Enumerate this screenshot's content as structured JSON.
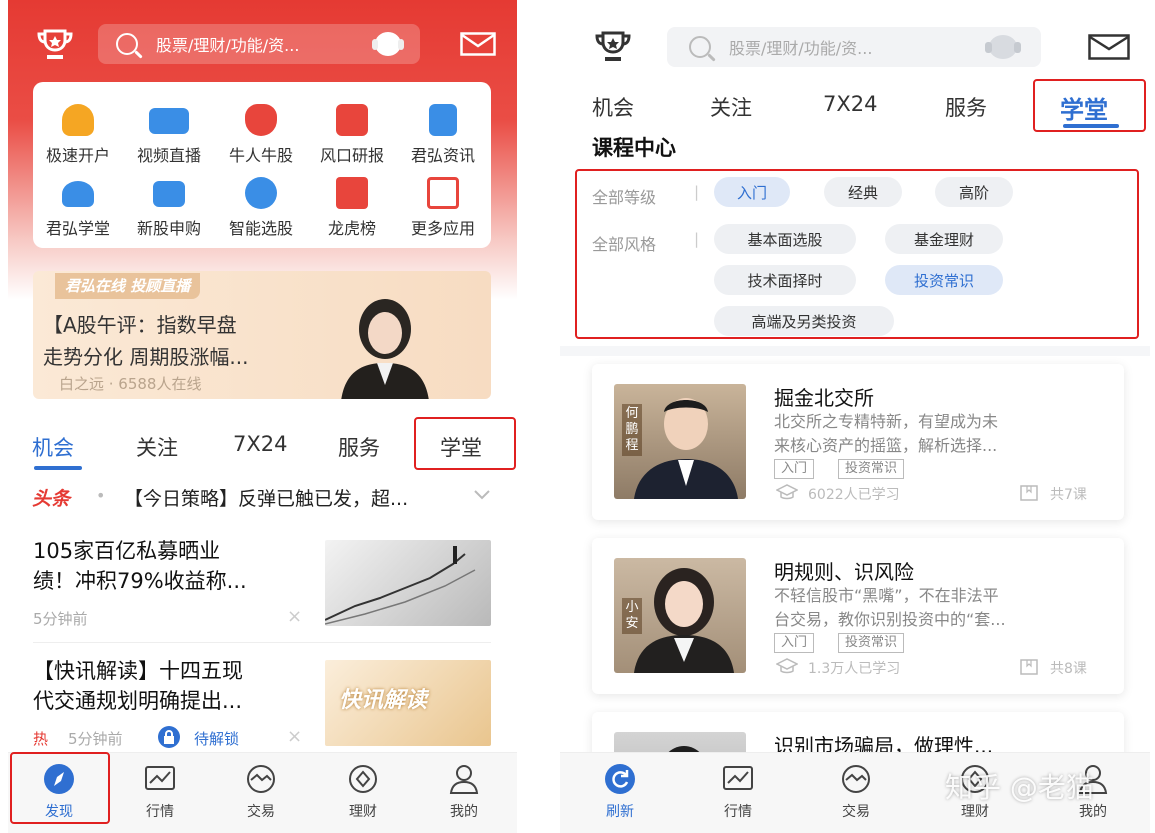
{
  "left": {
    "search_placeholder": "股票/理财/功能/资...",
    "grid": [
      {
        "label": "极速开户",
        "icon": "user-account-icon",
        "color": "#f5a623"
      },
      {
        "label": "视频直播",
        "icon": "video-camera-icon",
        "color": "#3a8ee6"
      },
      {
        "label": "牛人牛股",
        "icon": "bull-icon",
        "color": "#e8453c"
      },
      {
        "label": "风口研报",
        "icon": "report-icon",
        "color": "#e8453c"
      },
      {
        "label": "君弘资讯",
        "icon": "news-doc-icon",
        "color": "#3a8ee6"
      },
      {
        "label": "君弘学堂",
        "icon": "graduation-cap-icon",
        "color": "#3a8ee6"
      },
      {
        "label": "新股申购",
        "icon": "new-stock-icon",
        "color": "#3a8ee6"
      },
      {
        "label": "智能选股",
        "icon": "smart-pick-icon",
        "color": "#3a8ee6"
      },
      {
        "label": "龙虎榜",
        "icon": "star-badge-icon",
        "color": "#e8453c"
      },
      {
        "label": "更多应用",
        "icon": "more-apps-icon",
        "color": "#e8453c"
      }
    ],
    "banner": {
      "tag": "君弘在线 投顾直播",
      "line1": "【A股午评：指数早盘",
      "line2": "走势分化 周期股涨幅...",
      "meta": "白之远 · 6588人在线"
    },
    "tabs": [
      "机会",
      "关注",
      "7X24",
      "服务",
      "学堂"
    ],
    "headline_tag": "头条",
    "headline_dot": "•",
    "headline": "【今日策略】反弹已触已发，超...",
    "news": [
      {
        "title1": "105家百亿私募晒业",
        "title2": "绩！冲积79%收益称...",
        "meta": "5分钟前"
      },
      {
        "title1": "【快讯解读】十四五现",
        "title2": "代交通规划明确提出...",
        "hot": "热",
        "meta": "5分钟前",
        "lock": "待解锁",
        "thumb_text": "快讯解读"
      }
    ],
    "close_mark": "×",
    "nav": [
      "发现",
      "行情",
      "交易",
      "理财",
      "我的"
    ]
  },
  "right": {
    "search_placeholder": "股票/理财/功能/资...",
    "tabs": [
      "机会",
      "关注",
      "7X24",
      "服务",
      "学堂"
    ],
    "section_title": "课程中心",
    "filters": {
      "level_label": "全部等级",
      "levels": [
        "入门",
        "经典",
        "高阶"
      ],
      "style_label": "全部风格",
      "styles": [
        "基本面选股",
        "基金理财",
        "技术面择时",
        "投资常识",
        "高端及另类投资"
      ],
      "separator": "|"
    },
    "courses": [
      {
        "title": "掘金北交所",
        "desc1": "北交所之专精特新，有望成为未",
        "desc2": "来核心资产的摇篮，解析选择...",
        "tags": [
          "入门",
          "投资常识"
        ],
        "learners": "6022人已学习",
        "lessons": "共7课",
        "name_tag": "何鹏程"
      },
      {
        "title": "明规则、识风险",
        "desc1": "不轻信股市“黑嘴”，不在非法平",
        "desc2": "台交易，教你识别投资中的“套...",
        "tags": [
          "入门",
          "投资常识"
        ],
        "learners": "1.3万人已学习",
        "lessons": "共8课",
        "name_tag": "小安"
      },
      {
        "title": "识别市场骗局，做理性..."
      }
    ],
    "nav": [
      "刷新",
      "行情",
      "交易",
      "理财",
      "我的"
    ],
    "watermark": "知乎 @老猫"
  },
  "colors": {
    "brand_red": "#e53a33",
    "accent_blue": "#2f6fd1",
    "annot_red": "#e02020"
  }
}
